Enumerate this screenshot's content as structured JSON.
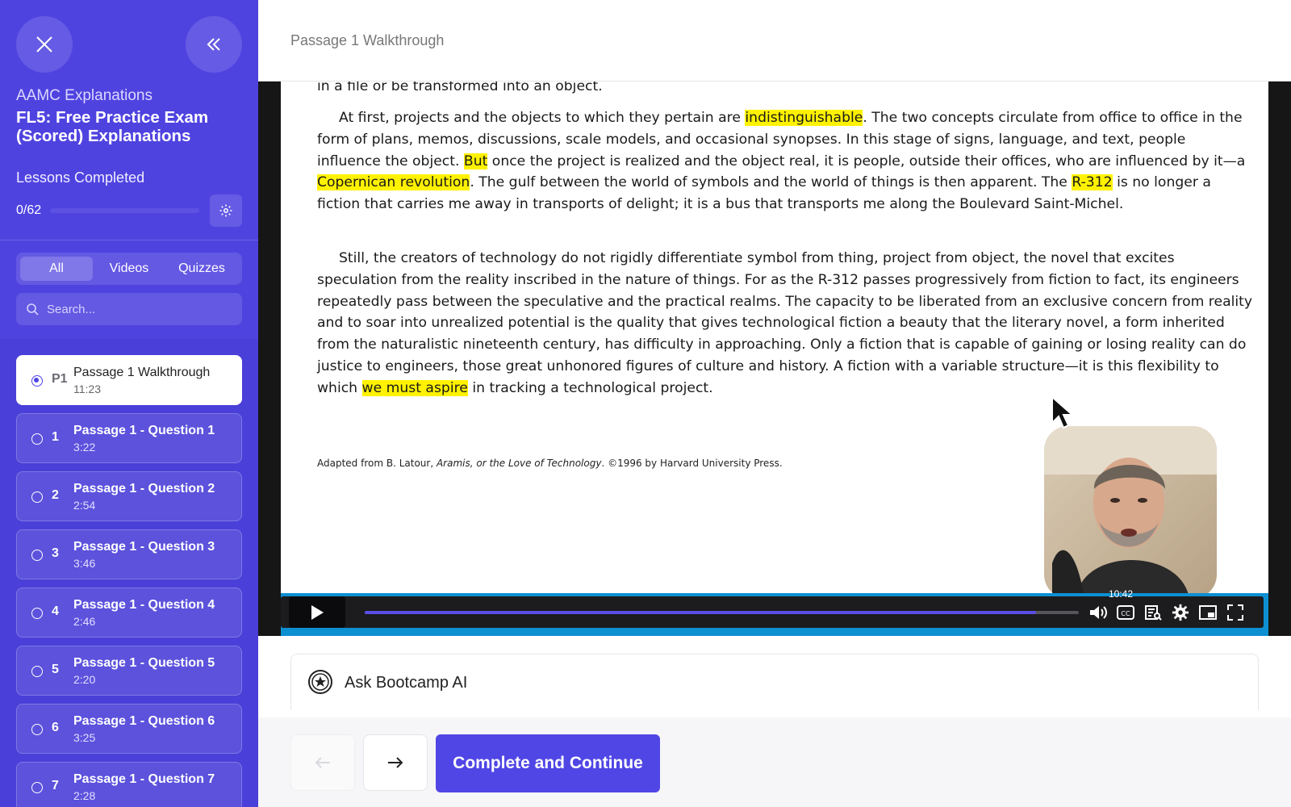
{
  "sidebar": {
    "kicker": "AAMC Explanations",
    "title": "FL5: Free Practice Exam (Scored) Explanations",
    "lessons_completed_label": "Lessons Completed",
    "progress_text": "0/62",
    "progress_fraction": 0,
    "filters": [
      "All",
      "Videos",
      "Quizzes"
    ],
    "active_filter": "All",
    "search_placeholder": "Search...",
    "lessons": [
      {
        "num": "P1",
        "title": "Passage 1 Walkthrough",
        "duration": "11:23",
        "active": true
      },
      {
        "num": "1",
        "title": "Passage 1 - Question 1",
        "duration": "3:22",
        "active": false
      },
      {
        "num": "2",
        "title": "Passage 1 - Question 2",
        "duration": "2:54",
        "active": false
      },
      {
        "num": "3",
        "title": "Passage 1 - Question 3",
        "duration": "3:46",
        "active": false
      },
      {
        "num": "4",
        "title": "Passage 1 - Question 4",
        "duration": "2:46",
        "active": false
      },
      {
        "num": "5",
        "title": "Passage 1 - Question 5",
        "duration": "2:20",
        "active": false
      },
      {
        "num": "6",
        "title": "Passage 1 - Question 6",
        "duration": "3:25",
        "active": false
      },
      {
        "num": "7",
        "title": "Passage 1 - Question 7",
        "duration": "2:28",
        "active": false
      }
    ]
  },
  "header": {
    "title": "Passage 1 Walkthrough"
  },
  "passage": {
    "top_line": "in a file or be transformed into an object.",
    "p1": {
      "a": "At first, projects and the objects to which they pertain are ",
      "h1": "indistinguishable",
      "b": ". The two concepts circulate from office to office in the form of plans, memos, discussions, scale models, and occasional synopses. In this stage of signs, language, and text, people influence the object. ",
      "h2": "But",
      "c": " once the project is realized and the object real, it is people, outside their offices, who are influenced by it—a ",
      "h3": "Copernican revolution",
      "d": ". The gulf between the world of symbols and the world of things is then apparent. The ",
      "h4": "R-312",
      "e": " is no longer a fiction that carries me away in transports of delight; it is a bus that transports me along the Boulevard Saint-Michel."
    },
    "p2": {
      "a": "Still, the creators of technology do not rigidly differentiate symbol from thing, project from object, the novel that excites speculation from the reality inscribed in the nature of things. For as the R-312 passes progressively from fiction to fact, its engineers repeatedly pass between the speculative and the practical realms. The capacity to be liberated from an exclusive concern from reality and to soar into unrealized potential is the quality that gives technological fiction a beauty that the literary novel, a form inherited from the naturalistic nineteenth century, has difficulty in approaching. Only a fiction that is capable of gaining or losing reality can do justice to engineers, those great unhonored figures of culture and history. A fiction with a variable structure—it is this flexibility to which ",
      "h1": "we must aspire",
      "b": " in tracking a technological project."
    },
    "citation": {
      "pre": "Adapted from B. Latour, ",
      "work": "Aramis, or the Love of Technology",
      "post": ". ©1996 by Harvard University Press."
    }
  },
  "player": {
    "hover_time": "10:42",
    "progress_fraction": 0.94,
    "icons": [
      "play-icon",
      "volume-icon",
      "captions-icon",
      "transcript-icon",
      "settings-icon",
      "picture-in-picture-icon",
      "fullscreen-icon"
    ],
    "accent_color": "#0d8fd1",
    "progress_color": "#5b4ee6"
  },
  "ask_ai": {
    "label": "Ask Bootcamp AI"
  },
  "footer": {
    "complete_label": "Complete and Continue"
  },
  "colors": {
    "sidebar": "#4a3fd8",
    "brand": "#5046e5",
    "highlight": "#fff200"
  }
}
